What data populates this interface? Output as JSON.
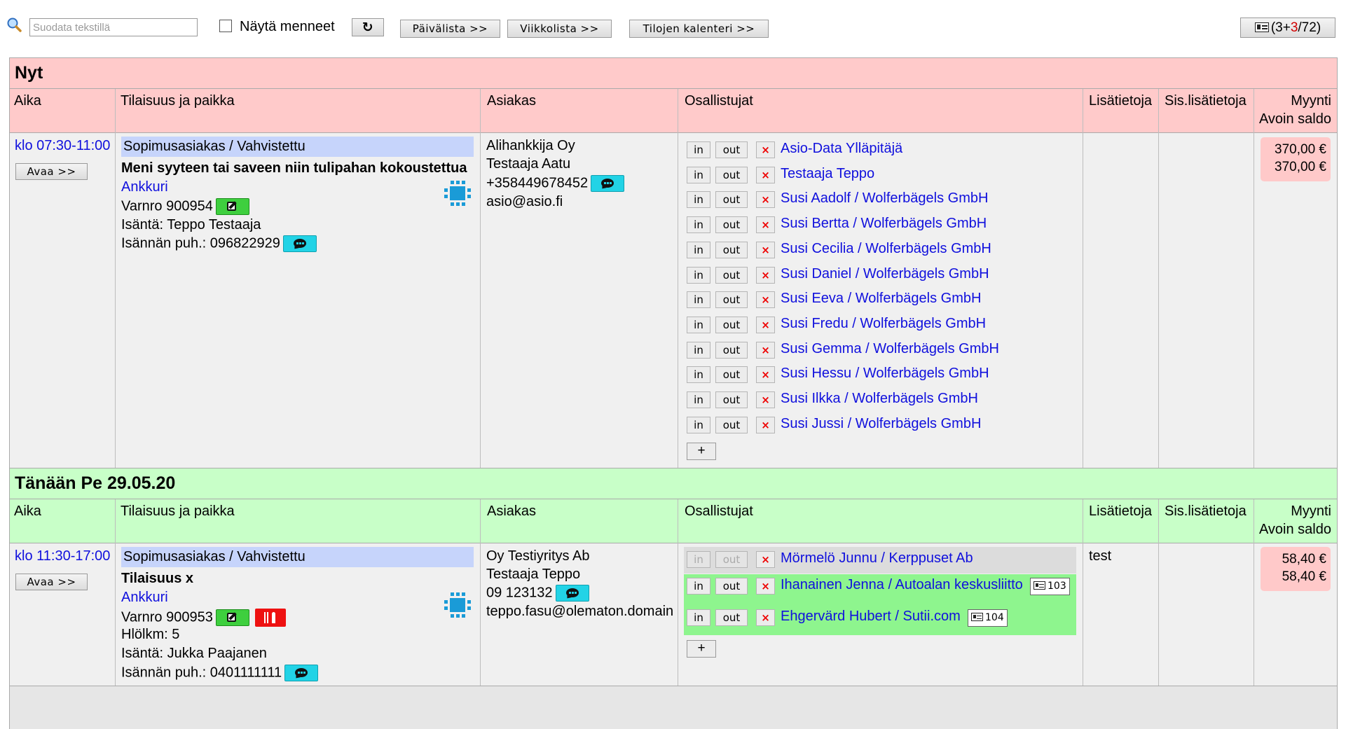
{
  "toolbar": {
    "search_placeholder": "Suodata tekstillä",
    "show_past_label": "Näytä menneet",
    "refresh_label": "↻",
    "day_list_label": "Päivälista >>",
    "week_list_label": "Viikkolista >>",
    "rooms_calendar_label": "Tilojen kalenteri >>",
    "count_prefix": "(3+",
    "count_red": "3",
    "count_suffix": "/72)"
  },
  "columns": {
    "time": "Aika",
    "event": "Tilaisuus ja paikka",
    "customer": "Asiakas",
    "participants": "Osallistujat",
    "info": "Lisätietoja",
    "internal_info": "Sis.lisätietoja",
    "sales": "Myynti",
    "open_balance": "Avoin saldo"
  },
  "buttons": {
    "open": "Avaa >>",
    "in": "in",
    "out": "out",
    "remove": "×",
    "add": "+"
  },
  "sections": [
    {
      "title": "Nyt",
      "bg": "#ffcaca",
      "event": {
        "time": "klo 07:30-11:00",
        "status": "Sopimusasiakas / Vahvistettu",
        "title": "Meni syyteen tai saveen niin tulipahan kokoustettua",
        "place": "Ankkuri",
        "booking_no": "Varnro 900954",
        "host": "Isäntä: Teppo Testaaja",
        "host_phone": "Isännän puh.: 096822929",
        "customer": {
          "company": "Alihankkija Oy",
          "contact": "Testaaja Aatu",
          "phone": "+358449678452",
          "email": "asio@asio.fi"
        },
        "participants": [
          "Asio-Data Ylläpitäjä",
          "Testaaja Teppo",
          "Susi Aadolf / Wolferbägels GmbH",
          "Susi Bertta / Wolferbägels GmbH",
          "Susi Cecilia / Wolferbägels GmbH",
          "Susi Daniel / Wolferbägels GmbH",
          "Susi Eeva / Wolferbägels GmbH",
          "Susi Fredu / Wolferbägels GmbH",
          "Susi Gemma / Wolferbägels GmbH",
          "Susi Hessu / Wolferbägels GmbH",
          "Susi Ilkka / Wolferbägels GmbH",
          "Susi Jussi / Wolferbägels GmbH"
        ],
        "sales": "370,00 €",
        "open_balance": "370,00 €"
      }
    },
    {
      "title": "Tänään Pe 29.05.20",
      "bg": "#c8ffc8",
      "event": {
        "time": "klo 11:30-17:00",
        "status": "Sopimusasiakas / Vahvistettu",
        "title": "Tilaisuus x",
        "place": "Ankkuri",
        "booking_no": "Varnro 900953",
        "persons": "Hlölkm: 5",
        "host": "Isäntä: Jukka Paajanen",
        "host_phone": "Isännän puh.: 0401111111",
        "customer": {
          "company": "Oy Testiyritys Ab",
          "contact": "Testaaja Teppo",
          "phone": "09 123132",
          "email": "teppo.fasu@olematon.domain"
        },
        "participants": [
          {
            "name": "Mörmelö Junnu / Kerppuset Ab",
            "badge": ""
          },
          {
            "name": "Ihanainen Jenna / Autoalan keskusliitto",
            "badge": "103"
          },
          {
            "name": "Ehgervärd Hubert / Sutii.com",
            "badge": "104"
          }
        ],
        "info": "test",
        "sales": "58,40 €",
        "open_balance": "58,40 €"
      }
    }
  ]
}
